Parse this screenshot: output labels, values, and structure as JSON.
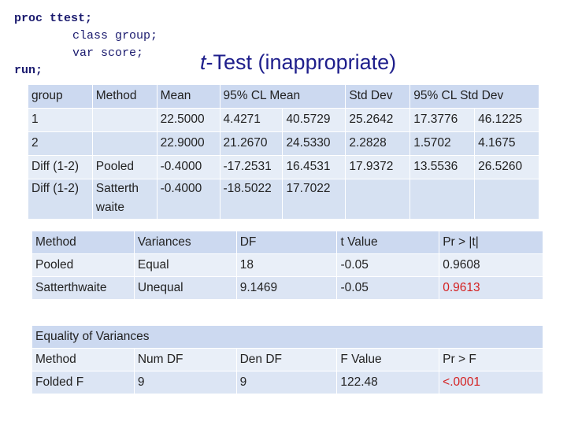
{
  "code": {
    "line1": "proc ttest;",
    "line2": "class group;",
    "line3": "var score;",
    "line4": "run;"
  },
  "title": {
    "italic": "t",
    "rest": "-Test (inappropriate)"
  },
  "table1": {
    "headers": [
      "group",
      "Method",
      "Mean",
      "95% CL Mean",
      "Std Dev",
      "95% CL Std Dev"
    ],
    "rows": [
      [
        "1",
        "",
        "22.5000",
        "4.4271",
        "40.5729",
        "25.2642",
        "17.3776",
        "46.1225"
      ],
      [
        "2",
        "",
        "22.9000",
        "21.2670",
        "24.5330",
        "2.2828",
        "1.5702",
        "4.1675"
      ],
      [
        "Diff (1-2)",
        "Pooled",
        "-0.4000",
        "-17.2531",
        "16.4531",
        "17.9372",
        "13.5536",
        "26.5260"
      ],
      [
        "Diff (1-2)",
        "Satterthwaite",
        "-0.4000",
        "-18.5022",
        "17.7022",
        "",
        "",
        ""
      ]
    ],
    "satterth_line1": "Satterth",
    "satterth_line2": "waite"
  },
  "table2": {
    "headers": [
      "Method",
      "Variances",
      "DF",
      "t Value",
      "Pr > |t|"
    ],
    "rows": [
      [
        "Pooled",
        "Equal",
        "18",
        "-0.05",
        "0.9608"
      ],
      [
        "Satterthwaite",
        "Unequal",
        "9.1469",
        "-0.05",
        "0.9613"
      ]
    ]
  },
  "table3": {
    "caption": "Equality of Variances",
    "headers": [
      "Method",
      "Num DF",
      "Den DF",
      "F Value",
      "Pr > F"
    ],
    "rows": [
      [
        "Folded F",
        "9",
        "9",
        "122.48",
        "<.0001"
      ]
    ]
  },
  "colors": {
    "highlight": "#d42020",
    "title": "#1f1f8c",
    "header_fill": "#ccd9f0"
  }
}
